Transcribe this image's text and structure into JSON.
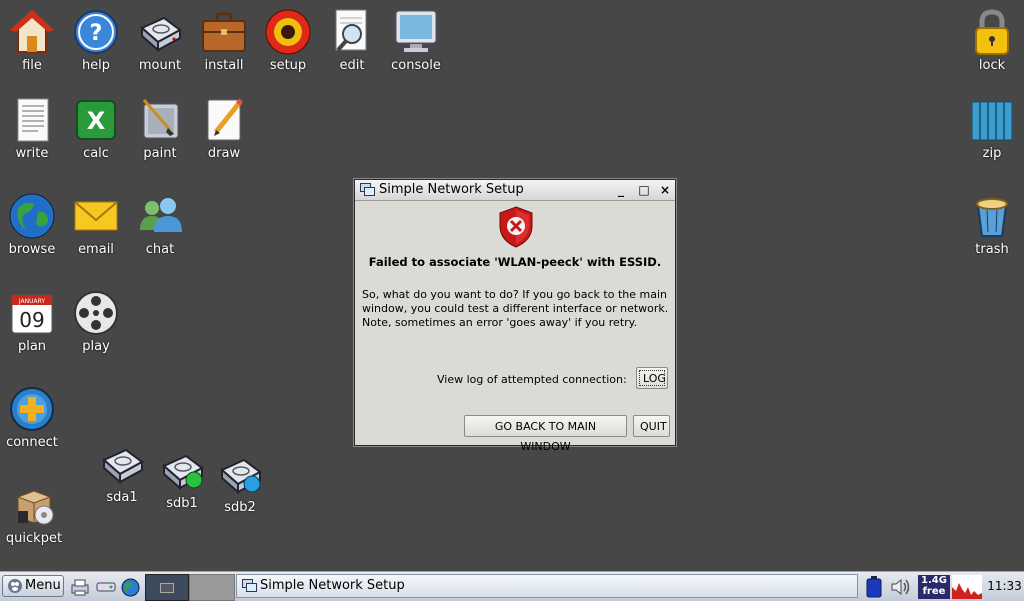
{
  "desktop": {
    "icons": {
      "file": "file",
      "help": "help",
      "mount": "mount",
      "install": "install",
      "setup": "setup",
      "edit": "edit",
      "console": "console",
      "lock": "lock",
      "write": "write",
      "calc": "calc",
      "paint": "paint",
      "draw": "draw",
      "zip": "zip",
      "browse": "browse",
      "email": "email",
      "chat": "chat",
      "trash": "trash",
      "plan": "plan",
      "play": "play",
      "connect": "connect",
      "sda1": "sda1",
      "sdb1": "sdb1",
      "sdb2": "sdb2",
      "quickpet": "quickpet"
    },
    "plan_calendar": {
      "month": "JANUARY",
      "day": "09"
    }
  },
  "dialog": {
    "title": "Simple Network Setup",
    "minimize": "_",
    "maximize": "□",
    "close": "×",
    "heading": "Failed to associate 'WLAN-peeck' with ESSID.",
    "message": "So, what do you want to do? If you go back to the main window, you could test a different interface or network. Note, sometimes an error 'goes away' if you retry.",
    "log_label": "View log of attempted connection:",
    "log_button": "LOG",
    "back_button": "GO BACK TO MAIN WINDOW",
    "quit_button": "QUIT"
  },
  "taskbar": {
    "menu_label": "Menu",
    "task_title": "Simple Network Setup",
    "free_space_value": "1.4G",
    "free_space_label": "free",
    "clock": "11:33"
  }
}
